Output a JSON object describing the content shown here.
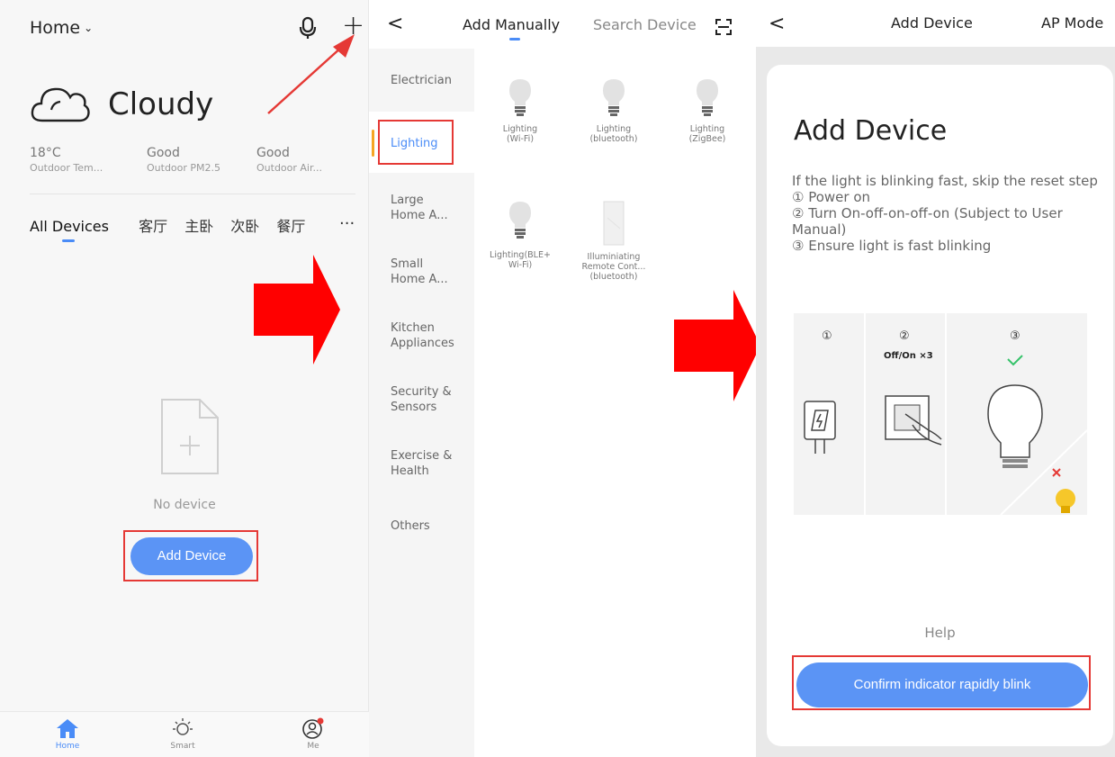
{
  "home": {
    "home_label": "Home",
    "weather": "Cloudy",
    "stats": [
      {
        "value": "18°C",
        "label": "Outdoor Tem..."
      },
      {
        "value": "Good",
        "label": "Outdoor PM2.5"
      },
      {
        "value": "Good",
        "label": "Outdoor Air..."
      }
    ],
    "tabs": [
      "All Devices",
      "客厅",
      "主卧",
      "次卧",
      "餐厅"
    ],
    "more": "···",
    "empty_text": "No device",
    "add_button": "Add Device",
    "nav": [
      {
        "label": "Home",
        "icon": "home-icon"
      },
      {
        "label": "Smart",
        "icon": "sun-icon"
      },
      {
        "label": "Me",
        "icon": "user-icon"
      }
    ]
  },
  "manual": {
    "tab_manual": "Add Manually",
    "tab_search": "Search Device",
    "categories": [
      "Electrician",
      "Lighting",
      "Large Home A...",
      "Small Home A...",
      "Kitchen Appliances",
      "Security & Sensors",
      "Exercise & Health",
      "Others"
    ],
    "devices": [
      {
        "l1": "Lighting",
        "l2": "(Wi-Fi)",
        "l3": ""
      },
      {
        "l1": "Lighting",
        "l2": "(bluetooth)",
        "l3": ""
      },
      {
        "l1": "Lighting",
        "l2": "(ZigBee)",
        "l3": ""
      },
      {
        "l1": "Lighting(BLE+",
        "l2": "Wi-Fi)",
        "l3": ""
      },
      {
        "l1": "Illuminiating",
        "l2": "Remote Cont...",
        "l3": "(bluetooth)"
      }
    ]
  },
  "adddevice": {
    "header_title": "Add Device",
    "ap_mode": "AP Mode",
    "heading": "Add Device",
    "instr1": "If the light is blinking fast, skip the reset step",
    "instr2": "① Power on",
    "instr3": "② Turn On-off-on-off-on (Subject to User Manual)",
    "instr4": "③ Ensure light is fast blinking",
    "step_labels": [
      "①",
      "②",
      "③"
    ],
    "step2_caption": "Off/On ×3",
    "help": "Help",
    "confirm_button": "Confirm indicator rapidly blink"
  },
  "colors": {
    "accent": "#5b94f5",
    "highlight": "#e53935",
    "arrow": "#ff0000"
  }
}
